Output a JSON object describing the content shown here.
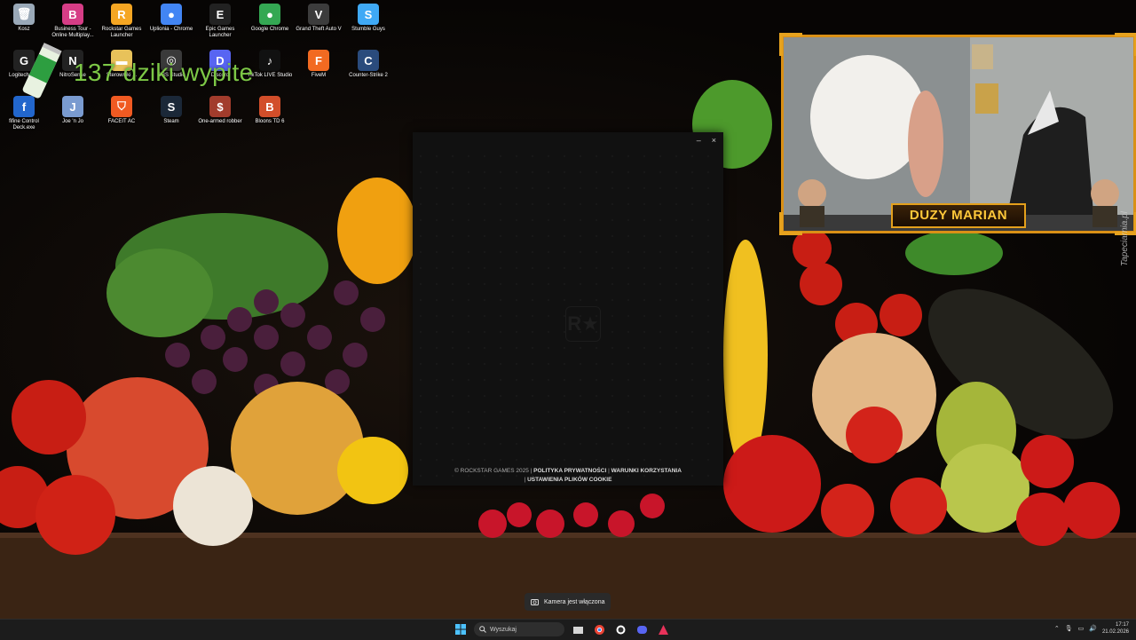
{
  "desktop": {
    "icons": [
      {
        "label": "Kosz",
        "icon": "recycle-bin-icon",
        "color": "#9aa9b8",
        "glyph": "🗑"
      },
      {
        "label": "Business Tour - Online Multiplay...",
        "icon": "business-tour-icon",
        "color": "#d63d86",
        "glyph": "B"
      },
      {
        "label": "Rockstar Games Launcher",
        "icon": "rockstar-icon",
        "color": "#f5a623",
        "glyph": "R"
      },
      {
        "label": "Uplionia - Chrome",
        "icon": "chrome-icon",
        "color": "#4285f4",
        "glyph": "●"
      },
      {
        "label": "Epic Games Launcher",
        "icon": "epic-games-icon",
        "color": "#222222",
        "glyph": "E"
      },
      {
        "label": "Google Chrome",
        "icon": "chrome-icon",
        "color": "#34a853",
        "glyph": "●"
      },
      {
        "label": "Grand Theft Auto V",
        "icon": "gta-v-icon",
        "color": "#3c3c3c",
        "glyph": "V"
      },
      {
        "label": "Stumble Guys",
        "icon": "stumble-guys-icon",
        "color": "#3fa9f5",
        "glyph": "S"
      },
      {
        "label": "Logitech G...",
        "icon": "logitech-icon",
        "color": "#222222",
        "glyph": "G"
      },
      {
        "label": "NitroSense",
        "icon": "nitrosense-icon",
        "color": "#222222",
        "glyph": "N"
      },
      {
        "label": "Sterowniki ...",
        "icon": "folder-icon",
        "color": "#e8c25a",
        "glyph": "▬"
      },
      {
        "label": "OBS Studio",
        "icon": "obs-icon",
        "color": "#3a3a3a",
        "glyph": "◎"
      },
      {
        "label": "Discord",
        "icon": "discord-icon",
        "color": "#5865f2",
        "glyph": "D"
      },
      {
        "label": "TikTok LIVE Studio",
        "icon": "tiktok-icon",
        "color": "#111111",
        "glyph": "♪"
      },
      {
        "label": "FiveM",
        "icon": "fivem-icon",
        "color": "#f26a21",
        "glyph": "F"
      },
      {
        "label": "Counter-Strike 2",
        "icon": "cs2-icon",
        "color": "#2a4b7c",
        "glyph": "C"
      },
      {
        "label": "fifine Control Deck.exe",
        "icon": "fifine-icon",
        "color": "#2266cc",
        "glyph": "f"
      },
      {
        "label": "Joe 'n Jo",
        "icon": "joe-n-jo-icon",
        "color": "#7a9bd0",
        "glyph": "J"
      },
      {
        "label": "FACEIT AC",
        "icon": "faceit-icon",
        "color": "#f05a22",
        "glyph": "⛉"
      },
      {
        "label": "Steam",
        "icon": "steam-icon",
        "color": "#1b2838",
        "glyph": "S"
      },
      {
        "label": "One-armed robber",
        "icon": "one-armed-robber-icon",
        "color": "#a23c2c",
        "glyph": "$"
      },
      {
        "label": "Bloons TD 6",
        "icon": "bloons-icon",
        "color": "#d24e2a",
        "glyph": "B"
      }
    ]
  },
  "overlay": {
    "counter_text": "137 dziki wypite"
  },
  "rockstar_window": {
    "minimize": "–",
    "close": "×",
    "logo": "R★",
    "copyright": "© ROCKSTAR GAMES 2025 |",
    "privacy": "POLITYKA PRYWATNOŚCI",
    "terms": "WARUNKI KORZYSTANIA",
    "cookies": "USTAWIENIA PLIKÓW COOKIE",
    "sep": "|"
  },
  "webcam": {
    "banner": "DUZY MARIAN"
  },
  "toast": {
    "text": "Kamera jest włączona"
  },
  "taskbar": {
    "search_placeholder": "Wyszukaj",
    "time": "17:17",
    "date": "21.02.2026"
  },
  "wallpaper": {
    "watermark": "Tapeciarnia.pl"
  }
}
